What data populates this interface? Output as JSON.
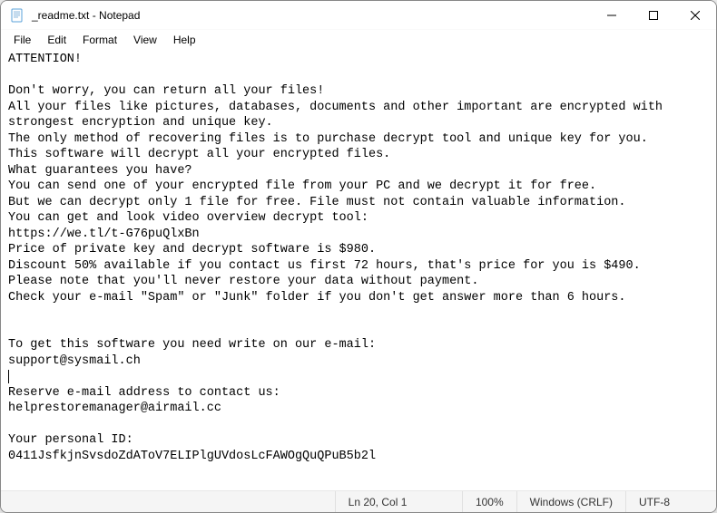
{
  "titlebar": {
    "title": "_readme.txt - Notepad"
  },
  "menubar": {
    "items": [
      {
        "label": "File"
      },
      {
        "label": "Edit"
      },
      {
        "label": "Format"
      },
      {
        "label": "View"
      },
      {
        "label": "Help"
      }
    ]
  },
  "content": {
    "lines": [
      "ATTENTION!",
      "",
      "Don't worry, you can return all your files!",
      "All your files like pictures, databases, documents and other important are encrypted with strongest encryption and unique key.",
      "The only method of recovering files is to purchase decrypt tool and unique key for you.",
      "This software will decrypt all your encrypted files.",
      "What guarantees you have?",
      "You can send one of your encrypted file from your PC and we decrypt it for free.",
      "But we can decrypt only 1 file for free. File must not contain valuable information.",
      "You can get and look video overview decrypt tool:",
      "https://we.tl/t-G76puQlxBn",
      "Price of private key and decrypt software is $980.",
      "Discount 50% available if you contact us first 72 hours, that's price for you is $490.",
      "Please note that you'll never restore your data without payment.",
      "Check your e-mail \"Spam\" or \"Junk\" folder if you don't get answer more than 6 hours.",
      "",
      "",
      "To get this software you need write on our e-mail:",
      "support@sysmail.ch",
      "",
      "Reserve e-mail address to contact us:",
      "helprestoremanager@airmail.cc",
      "",
      "Your personal ID:",
      "0411JsfkjnSvsdoZdAToV7ELIPlgUVdosLcFAWOgQuQPuB5b2l"
    ]
  },
  "statusbar": {
    "position": "Ln 20, Col 1",
    "zoom": "100%",
    "encoding": "Windows (CRLF)",
    "charset": "UTF-8"
  }
}
